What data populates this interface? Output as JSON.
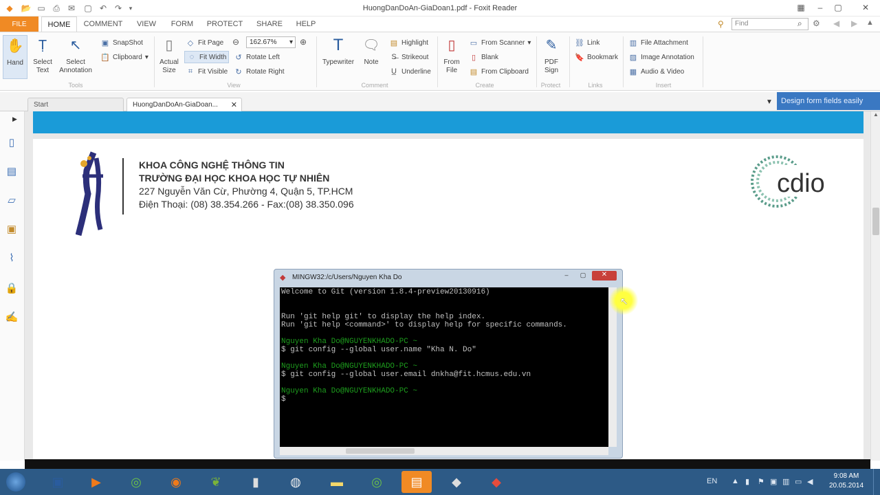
{
  "window": {
    "title": "HuongDanDoAn-GiaDoan1.pdf - Foxit Reader"
  },
  "menu": {
    "file": "FILE",
    "tabs": [
      "HOME",
      "COMMENT",
      "VIEW",
      "FORM",
      "PROTECT",
      "SHARE",
      "HELP"
    ],
    "find_placeholder": "Find"
  },
  "ribbon": {
    "tools": {
      "hand": "Hand",
      "select_text": "Select Text",
      "select_annotation": "Select Annotation",
      "snapshot": "SnapShot",
      "clipboard": "Clipboard",
      "label": "Tools"
    },
    "view": {
      "actual_size": "Actual Size",
      "fit_page": "Fit Page",
      "fit_width": "Fit Width",
      "fit_visible": "Fit Visible",
      "zoom": "162.67%",
      "rotate_left": "Rotate Left",
      "rotate_right": "Rotate Right",
      "label": "View"
    },
    "comment": {
      "typewriter": "Typewriter",
      "note": "Note",
      "highlight": "Highlight",
      "strikeout": "Strikeout",
      "underline": "Underline",
      "label": "Comment"
    },
    "create": {
      "from_file": "From File",
      "from_scanner": "From Scanner",
      "blank": "Blank",
      "from_clipboard": "From Clipboard",
      "label": "Create"
    },
    "protect": {
      "pdf_sign": "PDF Sign",
      "label": "Protect"
    },
    "links": {
      "link": "Link",
      "bookmark": "Bookmark",
      "label": "Links"
    },
    "insert": {
      "file_attachment": "File Attachment",
      "image_annotation": "Image Annotation",
      "audio_video": "Audio & Video",
      "label": "Insert"
    }
  },
  "doc_tabs": [
    "Start",
    "HuongDanDoAn-GiaDoan..."
  ],
  "banner": "Design form fields easily",
  "page": {
    "line1": "KHOA CÔNG NGHỆ THÔNG TIN",
    "line2": "TRƯỜNG ĐẠI HỌC KHOA HỌC TỰ NHIÊN",
    "line3": "227 Nguyễn Văn Cừ, Phường 4, Quận 5, TP.HCM",
    "line4": "Điện Thoại: (08) 38.354.266 - Fax:(08) 38.350.096",
    "cdio_logo": "cdio"
  },
  "terminal": {
    "title": "MINGW32:/c/Users/Nguyen Kha Do",
    "lines": [
      {
        "text": "Welcome to Git (version 1.8.4-preview20130916)",
        "green": false
      },
      {
        "text": "",
        "green": false
      },
      {
        "text": "",
        "green": false
      },
      {
        "text": "Run 'git help git' to display the help index.",
        "green": false
      },
      {
        "text": "Run 'git help <command>' to display help for specific commands.",
        "green": false
      },
      {
        "text": "",
        "green": false
      },
      {
        "text": "Nguyen Kha Do@NGUYENKHADO-PC ~",
        "green": true
      },
      {
        "text": "$ git config --global user.name \"Kha N. Do\"",
        "green": false
      },
      {
        "text": "",
        "green": false
      },
      {
        "text": "Nguyen Kha Do@NGUYENKHADO-PC ~",
        "green": true
      },
      {
        "text": "$ git config --global user.email dnkha@fit.hcmus.edu.vn",
        "green": false
      },
      {
        "text": "",
        "green": false
      },
      {
        "text": "Nguyen Kha Do@NGUYENKHADO-PC ~",
        "green": true
      },
      {
        "text": "$",
        "green": false
      }
    ]
  },
  "taskbar": {
    "language": "EN",
    "time": "9:08 AM",
    "date": "20.05.2014"
  }
}
